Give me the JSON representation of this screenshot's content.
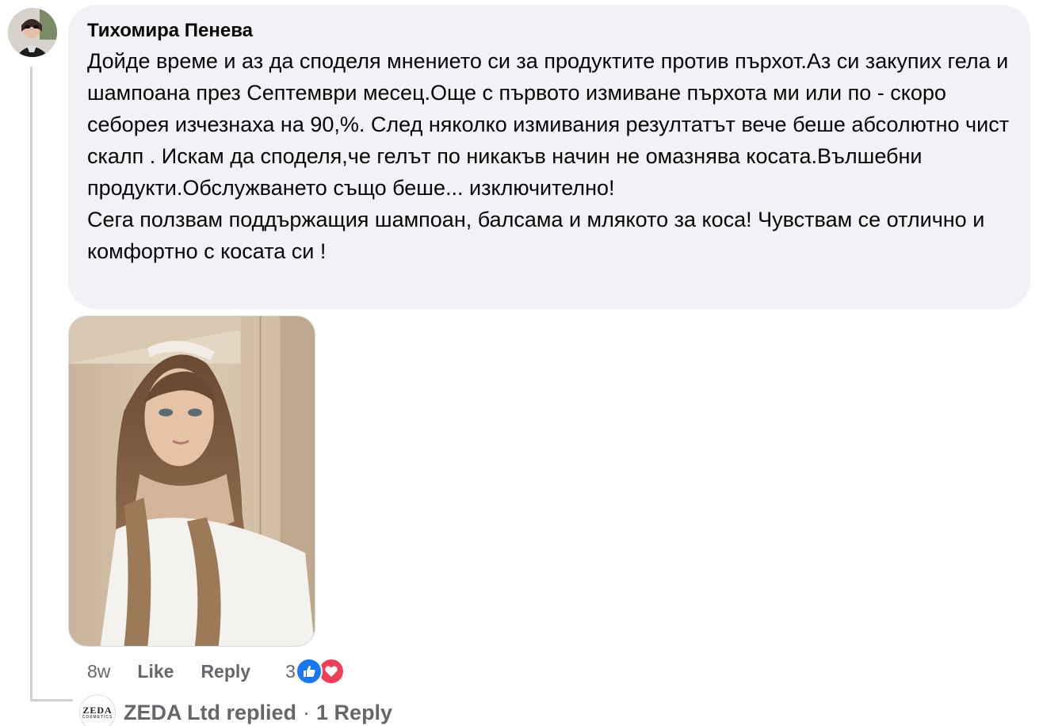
{
  "comment": {
    "author": "Тихомира Пенева",
    "text": "Дойде време и аз да споделя мнението си за продуктите против пърхот.Аз си закупих гела и шампоана през Септември месец.Още с първото измиване пърхота ми или по - скоро себорея изчезнаха на 90,%. След няколко измивания резултатът вече беше абсолютно чист скалп . Искам да споделя,че гелът по никакъв начин не омазнява косата.Вълшебни продукти.Обслужването също беше... изключително!\nСега ползвам поддържащия шампоан, балсама и млякото за коса! Чувствам се отлично и комфортно с косата си !",
    "age": "8w",
    "like_label": "Like",
    "reply_label": "Reply",
    "reaction_count": "3",
    "reaction_icons": [
      "like-icon",
      "love-icon"
    ]
  },
  "reply_summary": {
    "avatar_logo": "ZEDA",
    "avatar_logo_sub": "COSMETICS",
    "author": "ZEDA Ltd",
    "action": "replied",
    "separator": "·",
    "count_label": "1 Reply"
  },
  "colors": {
    "bubble_bg": "#f0f2f5",
    "secondary_text": "#65676b",
    "like_blue": "#1877f2",
    "love_red": "#f33e58"
  }
}
